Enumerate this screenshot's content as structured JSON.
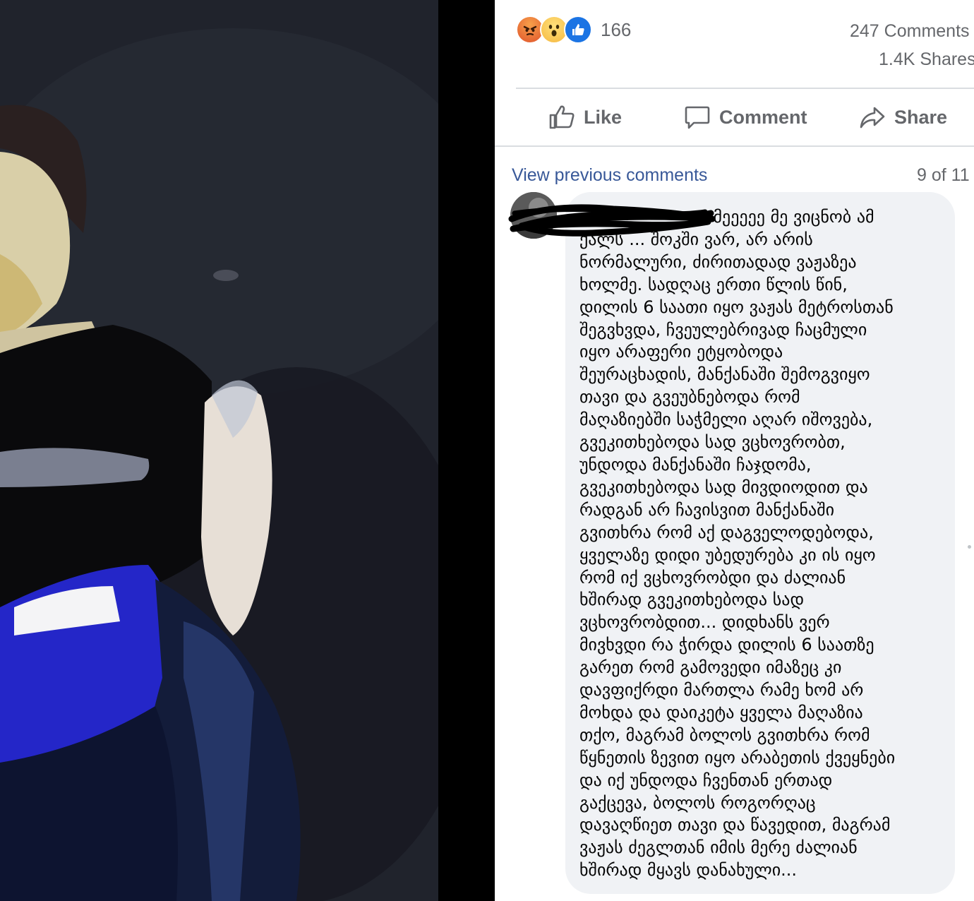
{
  "post": {
    "reaction_count": "166",
    "comments_count": "247 Comments",
    "shares_count": "1.4K Shares",
    "reactions": [
      {
        "name": "angry-reaction-icon",
        "color": "#e0542c"
      },
      {
        "name": "wow-reaction-icon",
        "color": "#f5b840"
      },
      {
        "name": "like-reaction-icon",
        "color": "#1b74e4"
      }
    ]
  },
  "actions": {
    "like_label": "Like",
    "comment_label": "Comment",
    "share_label": "Share"
  },
  "comments": {
    "view_previous": "View previous comments",
    "pagination": "9 of 11",
    "comment": {
      "text": "                    ვაიმეეეეე მე ვიცნობ ამ\nქალს ... შოკში ვარ, არ არის\nნორმალური, ძირითადად ვაჟაზეა\nხოლმე. სადღაც ერთი წლის წინ,\nდილის 6 საათი იყო ვაჟას მეტროსთან\nშეგვხვდა, ჩვეულებრივად ჩაცმული\nიყო არაფერი ეტყობოდა\nშეურაცხადის, მანქანაში შემოგვიყო\nთავი და გვეუბნებოდა რომ\nმაღაზიებში საჭმელი აღარ იშოვება,\nგვეკითხებოდა სად ვცხოვრობთ,\nუნდოდა მანქანაში ჩაჯდომა,\nგვეკითხებოდა სად მივდიოდით და\nრადგან არ ჩავისვით მანქანაში\nგვითხრა რომ აქ დაგველოდებოდა,\nყველაზე დიდი უბედურება კი ის იყო\nრომ იქ ვცხოვრობდი და ძალიან\nხშირად გვეკითხებოდა სად\nვცხოვრობდით... დიდხანს ვერ\nმივხვდი რა ჭირდა დილის 6 საათზე\nგარეთ რომ გამოვედი იმაზეც კი\nდავფიქრდი მართლა რამე ხომ არ\nმოხდა და დაიკეტა ყველა მაღაზია\nთქო, მაგრამ ბოლოს გვითხრა რომ\nწყნეთის ზევით იყო არაბეთის ქვეყნები\nდა იქ უნდოდა ჩვენთან ერთად\nგაქცევა, ბოლოს როგორღაც\nდავაღწიეთ თავი და წავედით, მაგრამ\nვაჟას ძეგლთან იმის მერე ძალიან\nხშირად მყავს დანახული..."
    }
  },
  "colors": {
    "link": "#385898",
    "secondary_text": "#65676b",
    "bubble": "#f0f2f5"
  }
}
